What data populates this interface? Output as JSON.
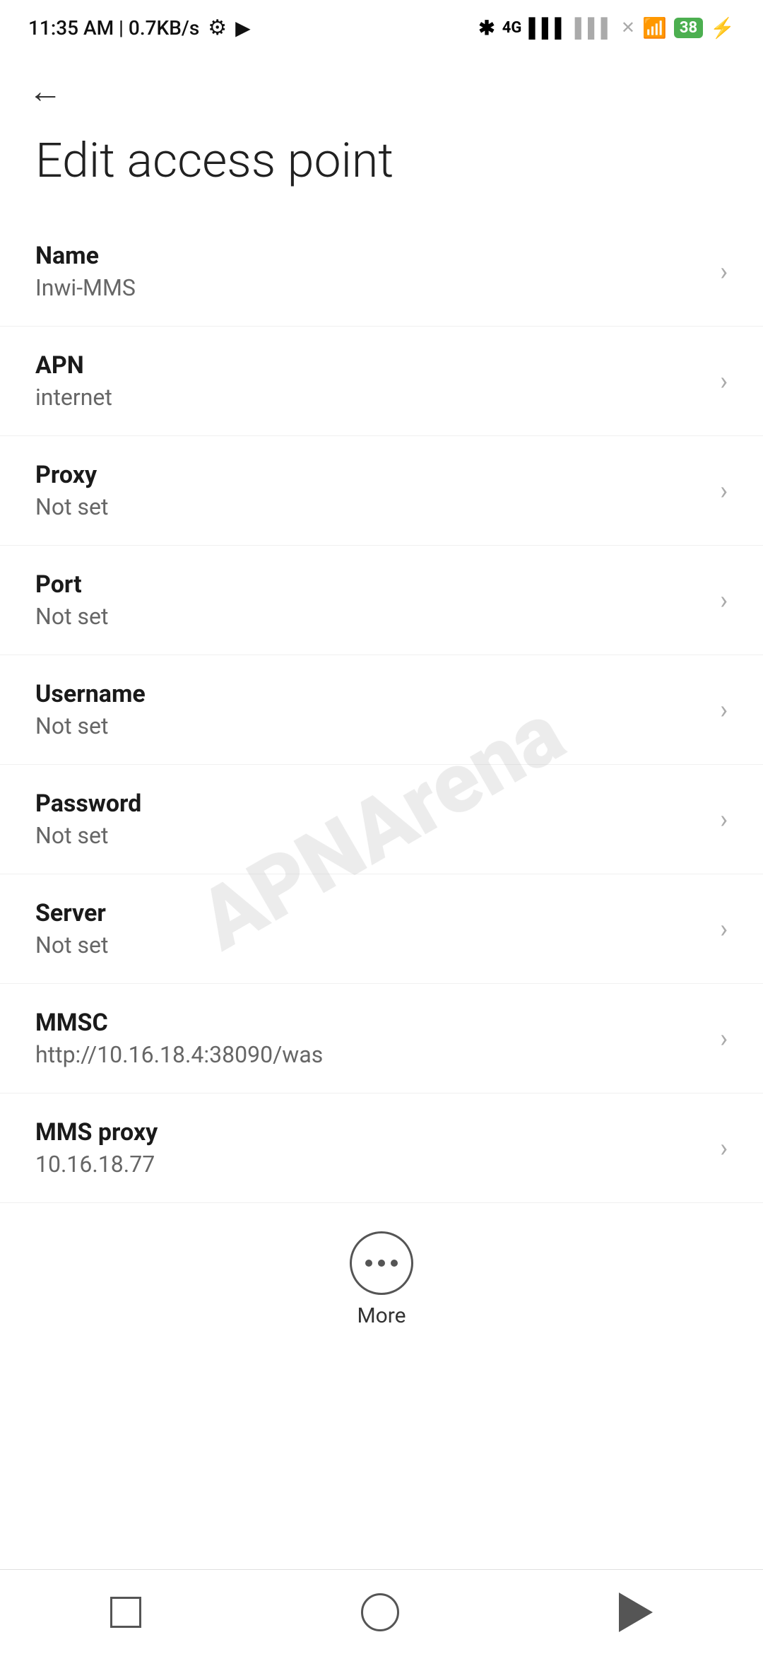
{
  "statusBar": {
    "time": "11:35 AM | 0.7KB/s",
    "battery": "38"
  },
  "page": {
    "title": "Edit access point"
  },
  "fields": [
    {
      "label": "Name",
      "value": "Inwi-MMS"
    },
    {
      "label": "APN",
      "value": "internet"
    },
    {
      "label": "Proxy",
      "value": "Not set"
    },
    {
      "label": "Port",
      "value": "Not set"
    },
    {
      "label": "Username",
      "value": "Not set"
    },
    {
      "label": "Password",
      "value": "Not set"
    },
    {
      "label": "Server",
      "value": "Not set"
    },
    {
      "label": "MMSC",
      "value": "http://10.16.18.4:38090/was"
    },
    {
      "label": "MMS proxy",
      "value": "10.16.18.77"
    }
  ],
  "more": {
    "label": "More"
  },
  "nav": {
    "back": "back",
    "home": "home",
    "recent": "recent"
  },
  "watermark": {
    "text": "APNArena"
  }
}
